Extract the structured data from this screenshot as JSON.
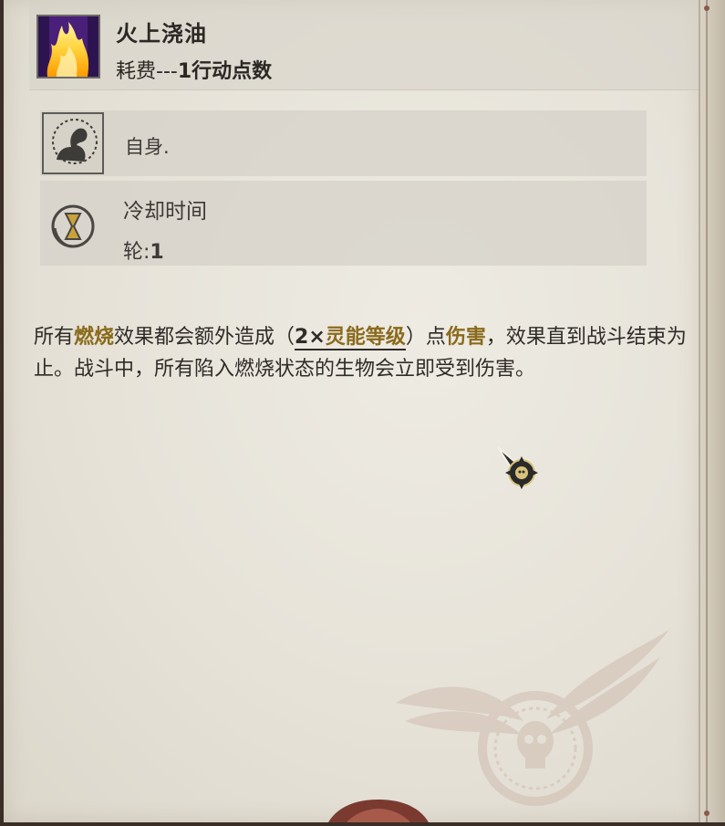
{
  "ability": {
    "title": "火上浇油",
    "cost_prefix": "耗费---",
    "cost_value": "1行动点数",
    "icon": "fire-flame-icon"
  },
  "target": {
    "icon": "flexed-arm-icon",
    "text": "自身."
  },
  "cooldown": {
    "icon": "hourglass-icon",
    "label": "冷却时间",
    "rounds_prefix": "轮:",
    "rounds_value": "1"
  },
  "description": {
    "p1": "所有",
    "k1": "燃烧",
    "p2": "效果都会额外造成（",
    "n1": "2×",
    "k2": "灵能等级",
    "p3": "）点",
    "k3": "伤害",
    "p4": "，效果直到战斗结束为止。战斗中，",
    "u1": "所有陷入燃烧",
    "p5": "状态的生物会立即受到伤害。"
  },
  "colors": {
    "keyword": "#8a6a1c",
    "text": "#2f2b27",
    "panel": "#e6e2d8"
  },
  "decorations": {
    "cursor": "pointer-cursor-icon",
    "watermark": "winged-skull-emblem-icon"
  }
}
